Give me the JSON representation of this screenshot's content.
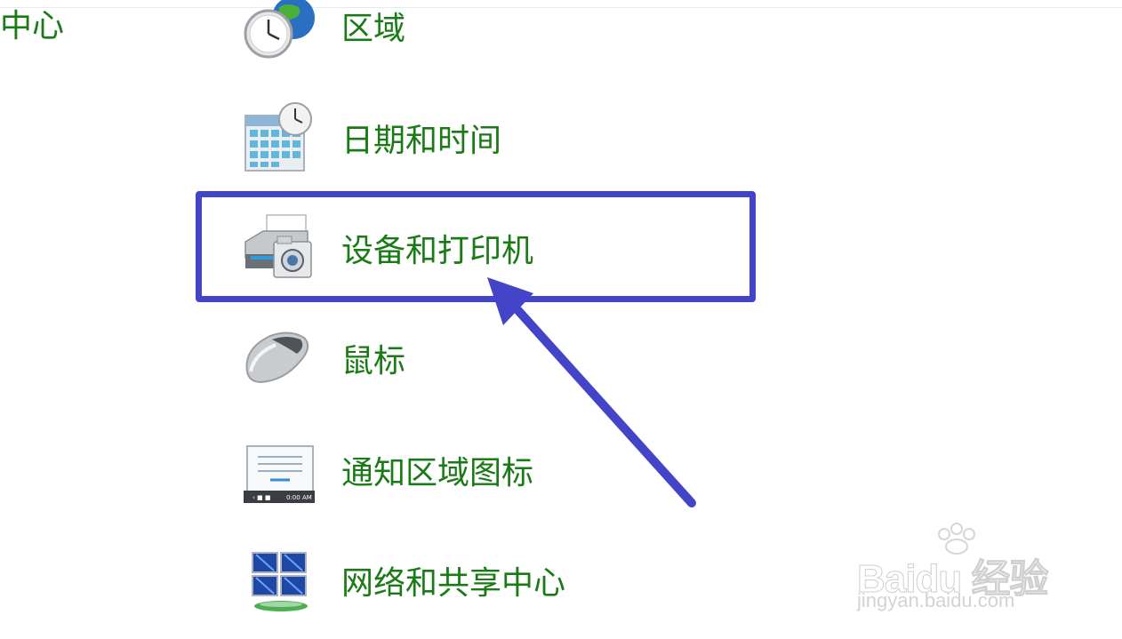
{
  "left_partial_label": "中心",
  "items": [
    {
      "label": "区域",
      "icon": "globe-clock-icon"
    },
    {
      "label": "日期和时间",
      "icon": "calendar-clock-icon"
    },
    {
      "label": "设备和打印机",
      "icon": "printer-camera-icon"
    },
    {
      "label": "鼠标",
      "icon": "mouse-icon"
    },
    {
      "label": "通知区域图标",
      "icon": "notification-area-icon"
    },
    {
      "label": "网络和共享中心",
      "icon": "network-icon"
    }
  ],
  "notification_icon_time": "0:00 AM",
  "watermark": {
    "logo_text": "Baidu 经验",
    "url_text": "jingyan.baidu.com"
  },
  "colors": {
    "link": "#1a7b16",
    "highlight": "#4344c8"
  }
}
